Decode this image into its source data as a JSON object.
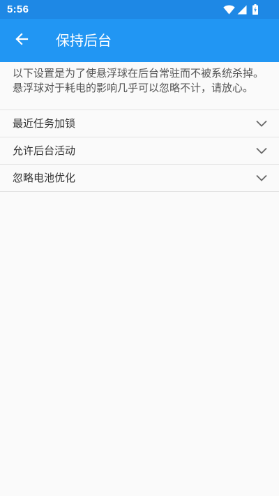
{
  "status_bar": {
    "time": "5:56",
    "icons": [
      "wifi-icon",
      "cellular-signal-icon",
      "battery-icon"
    ]
  },
  "app_bar": {
    "back_icon": "arrow-left-icon",
    "title": "保持后台"
  },
  "description": "以下设置是为了使悬浮球在后台常驻而不被系统杀掉。悬浮球对于耗电的影响几乎可以忽略不计，请放心。",
  "settings": [
    {
      "label": "最近任务加锁",
      "icon": "chevron-down-icon"
    },
    {
      "label": "允许后台活动",
      "icon": "chevron-down-icon"
    },
    {
      "label": "忽略电池优化",
      "icon": "chevron-down-icon"
    }
  ],
  "colors": {
    "status_bar": "#1e88e5",
    "app_bar": "#2196f3",
    "background": "#fafafa",
    "divider": "#e3e3e3"
  }
}
